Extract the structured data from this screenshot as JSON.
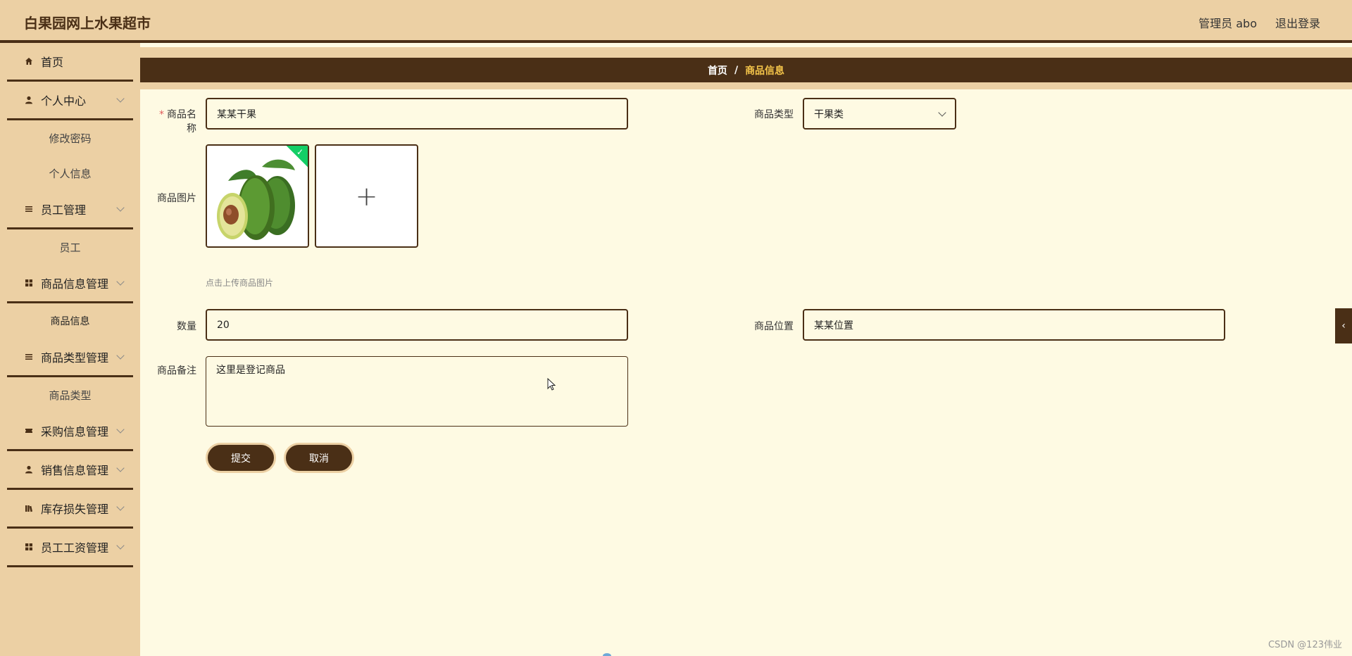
{
  "header": {
    "title": "白果园网上水果超市",
    "user_label": "管理员 abo",
    "logout_label": "退出登录"
  },
  "sidebar": {
    "items": [
      {
        "label": "首页",
        "icon": "home-icon"
      },
      {
        "label": "个人中心",
        "icon": "user-icon",
        "children": [
          "修改密码",
          "个人信息"
        ]
      },
      {
        "label": "员工管理",
        "icon": "list-icon",
        "children": [
          "员工"
        ]
      },
      {
        "label": "商品信息管理",
        "icon": "grid-icon",
        "children": [
          "商品信息"
        ]
      },
      {
        "label": "商品类型管理",
        "icon": "list-icon",
        "children": [
          "商品类型"
        ]
      },
      {
        "label": "采购信息管理",
        "icon": "ticket-icon"
      },
      {
        "label": "销售信息管理",
        "icon": "user-icon"
      },
      {
        "label": "库存损失管理",
        "icon": "books-icon"
      },
      {
        "label": "员工工资管理",
        "icon": "grid-icon"
      }
    ]
  },
  "breadcrumb": {
    "home": "首页",
    "separator": "/",
    "current": "商品信息"
  },
  "form": {
    "name_label": "商品名称",
    "name_value": "某某干果",
    "type_label": "商品类型",
    "type_value": "干果类",
    "image_label": "商品图片",
    "image_hint": "点击上传商品图片",
    "qty_label": "数量",
    "qty_value": "20",
    "location_label": "商品位置",
    "location_value": "某某位置",
    "remark_label": "商品备注",
    "remark_value": "这里是登记商品",
    "submit_label": "提交",
    "cancel_label": "取消"
  },
  "watermark": "CSDN @123伟业",
  "colors": {
    "brand_dark": "#4a2f16",
    "sidebar_bg": "#ecd0a4",
    "content_bg": "#fefae3",
    "accent_gold": "#f6c64a",
    "success_green": "#13ce66"
  }
}
